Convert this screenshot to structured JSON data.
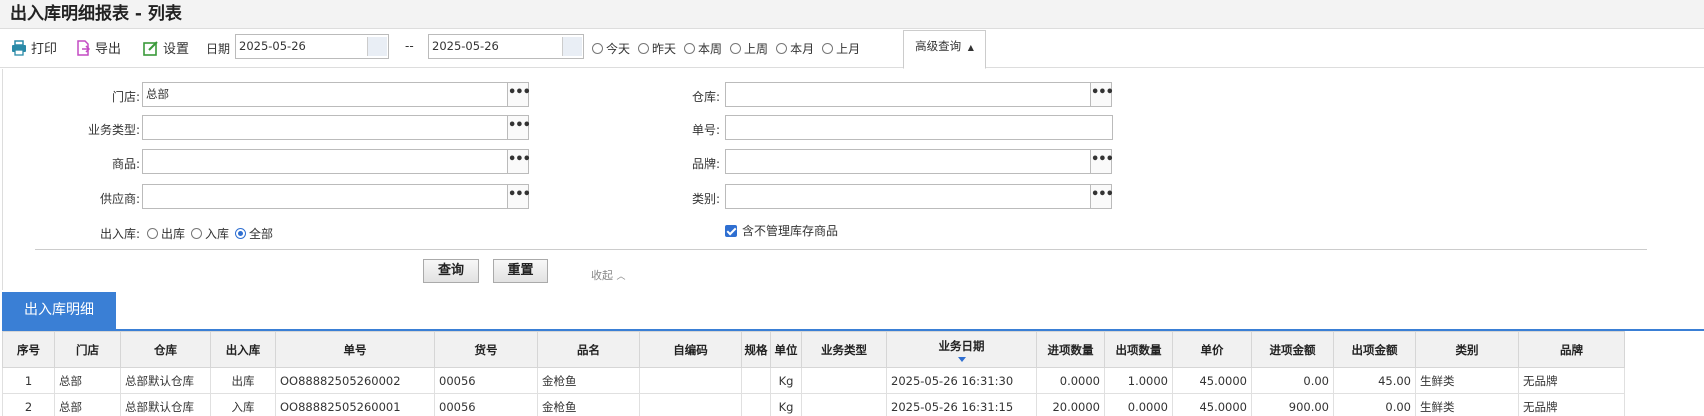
{
  "title": "出入库明细报表 - 列表",
  "toolbar": {
    "print": "打印",
    "export": "导出",
    "settings": "设置",
    "date_label": "日期",
    "date_from": "2025-05-26",
    "date_sep": "--",
    "date_to": "2025-05-26",
    "ranges": [
      "今天",
      "昨天",
      "本周",
      "上周",
      "本月",
      "上月"
    ],
    "advanced": "高级查询"
  },
  "filters": {
    "store_label": "门店:",
    "store_value": "总部",
    "warehouse_label": "仓库:",
    "biztype_label": "业务类型:",
    "docno_label": "单号:",
    "product_label": "商品:",
    "brand_label": "品牌:",
    "supplier_label": "供应商:",
    "category_label": "类别:",
    "inout_label": "出入库:",
    "inout_options": [
      "出库",
      "入库",
      "全部"
    ],
    "inout_selected": "全部",
    "include_unmanaged": "含不管理库存商品",
    "query": "查询",
    "reset": "重置",
    "collapse": "收起"
  },
  "section_tab": "出入库明细",
  "table": {
    "columns": [
      "序号",
      "门店",
      "仓库",
      "出入库",
      "单号",
      "货号",
      "品名",
      "自编码",
      "规格",
      "单位",
      "业务类型",
      "业务日期",
      "进项数量",
      "出项数量",
      "单价",
      "进项金额",
      "出项金额",
      "类别",
      "品牌"
    ],
    "rows": [
      [
        "1",
        "总部",
        "总部默认仓库",
        "出库",
        "OO88882505260002",
        "00056",
        "金枪鱼",
        "",
        "",
        "Kg",
        "",
        "2025-05-26 16:31:30",
        "0.0000",
        "1.0000",
        "45.0000",
        "0.00",
        "45.00",
        "生鲜类",
        "无品牌"
      ],
      [
        "2",
        "总部",
        "总部默认仓库",
        "入库",
        "OO88882505260001",
        "00056",
        "金枪鱼",
        "",
        "",
        "Kg",
        "",
        "2025-05-26 16:31:15",
        "20.0000",
        "0.0000",
        "45.0000",
        "900.00",
        "0.00",
        "生鲜类",
        "无品牌"
      ]
    ]
  },
  "colors": {
    "accent": "#3a7fd5",
    "header_bg": "#f1f1f1"
  }
}
